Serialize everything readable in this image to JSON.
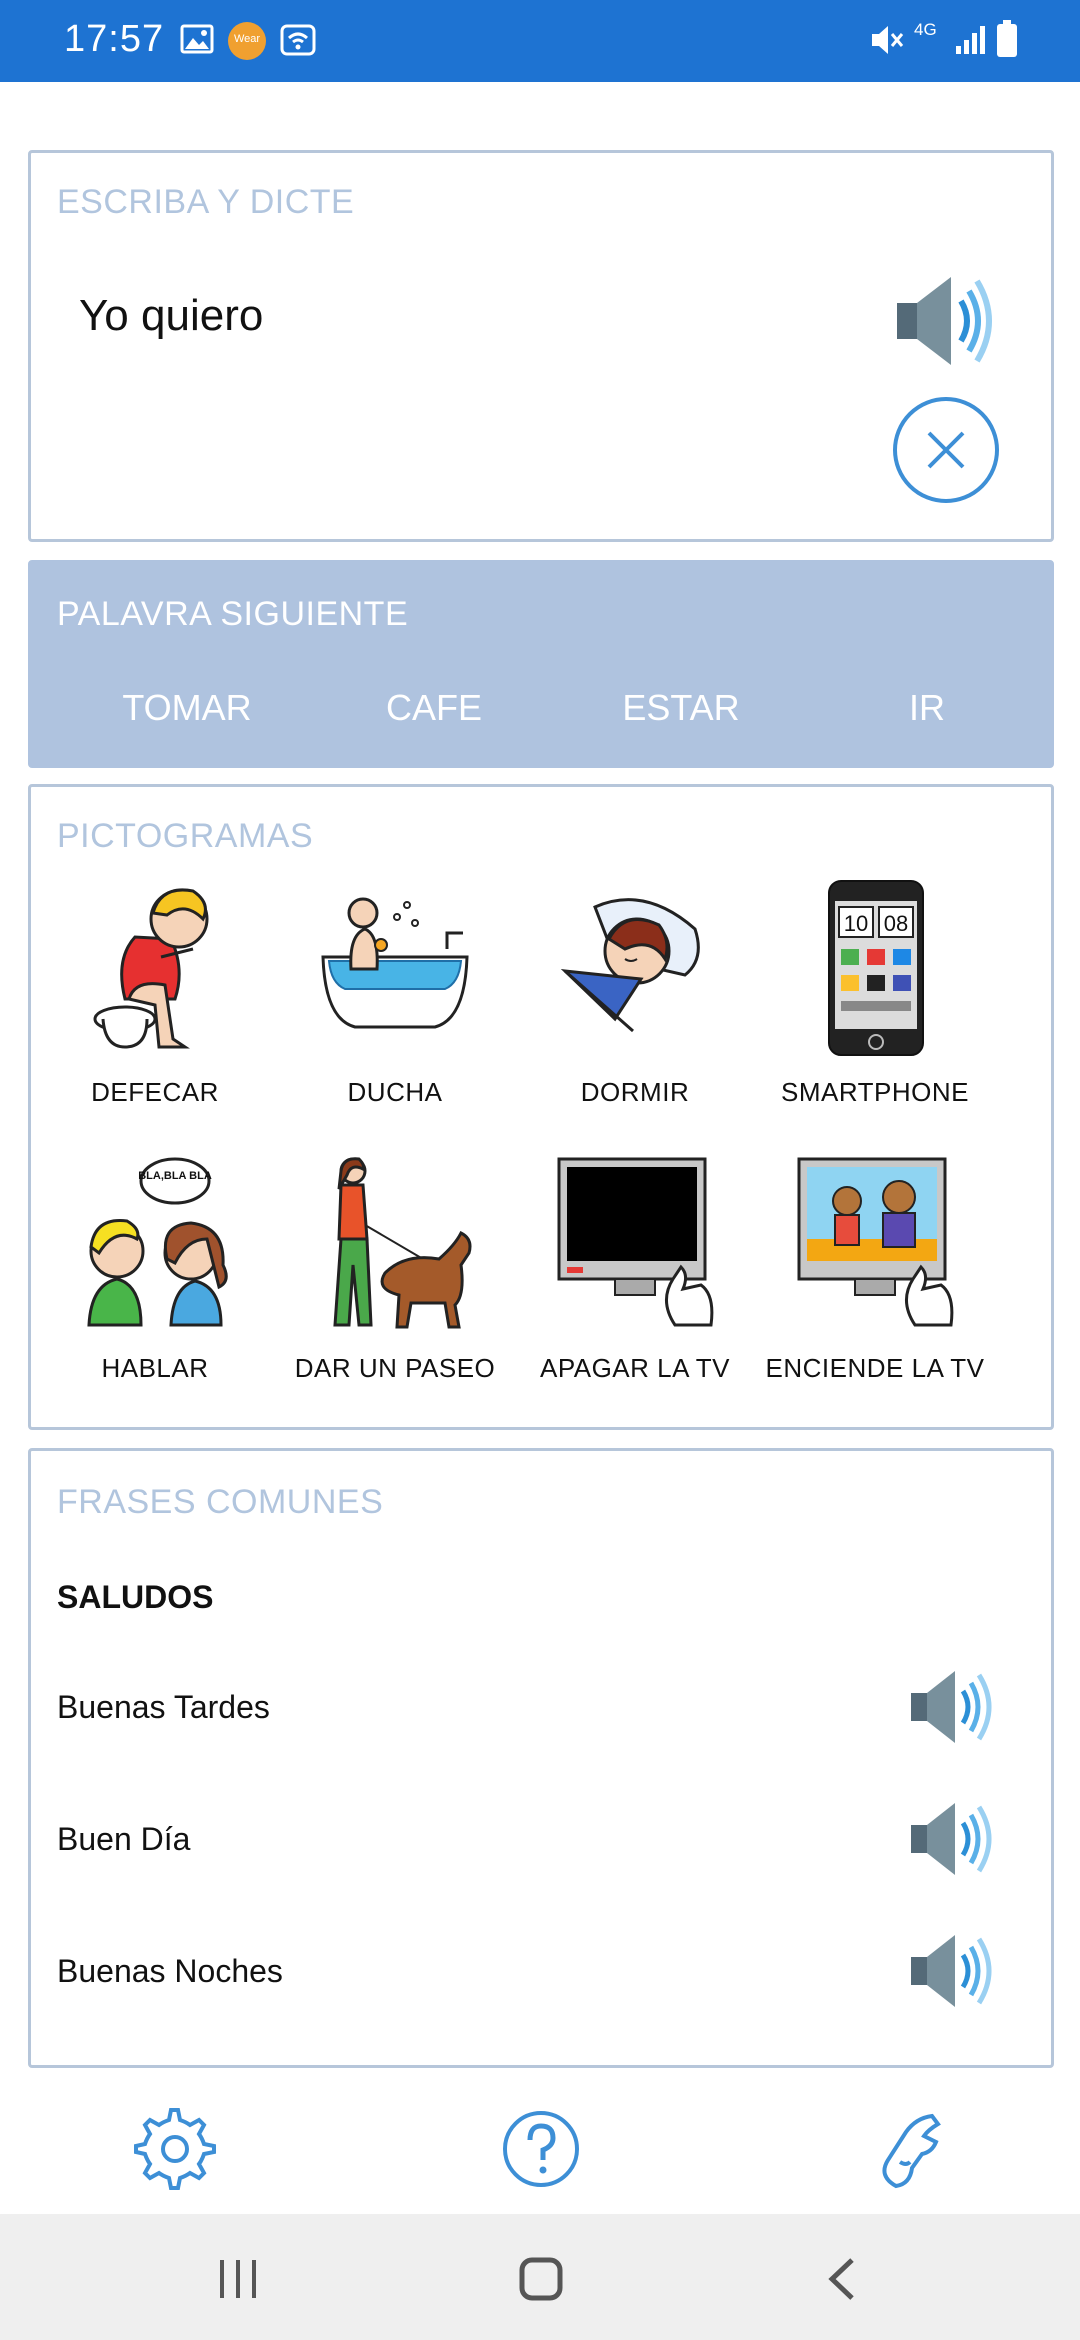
{
  "status_bar": {
    "time": "17:57",
    "wear_badge": "Wear",
    "network": "4G",
    "icons": [
      "gallery-icon",
      "wear-icon",
      "wifi-calling-icon",
      "mute-icon",
      "signal-icon",
      "battery-icon"
    ]
  },
  "dictate": {
    "title": "ESCRIBA Y DICTE",
    "phrase": "Yo quiero",
    "input_value": "",
    "speak_icon": "speaker-icon",
    "clear_icon": "close-icon"
  },
  "next_word": {
    "title": "PALAVRA SIGUIENTE",
    "words": [
      "TOMAR",
      "CAFE",
      "ESTAR",
      "IR"
    ]
  },
  "pictograms": {
    "title": "PICTOGRAMAS",
    "items": [
      {
        "label": "DEFECAR"
      },
      {
        "label": "DUCHA"
      },
      {
        "label": "DORMIR"
      },
      {
        "label": "SMARTPHONE",
        "clock": [
          "10",
          "08"
        ]
      },
      {
        "label": "HABLAR",
        "speech": "BLA,BLA BLA"
      },
      {
        "label": "DAR UN PASEO"
      },
      {
        "label": "APAGAR LA TV"
      },
      {
        "label": "ENCIENDE LA TV"
      }
    ]
  },
  "phrases": {
    "title": "FRASES COMUNES",
    "category": "SALUDOS",
    "items": [
      {
        "text": "Buenas Tardes"
      },
      {
        "text": "Buen Día"
      },
      {
        "text": "Buenas Noches"
      }
    ]
  },
  "toolbar": {
    "icons": [
      "settings-icon",
      "help-icon",
      "sign-language-icon"
    ]
  },
  "colors": {
    "status_bar": "#1e73d2",
    "accent": "#3d8fd6",
    "card_title": "#b1c5de",
    "next_word_bg": "#afc3df",
    "card_border": "#b6c6da"
  }
}
